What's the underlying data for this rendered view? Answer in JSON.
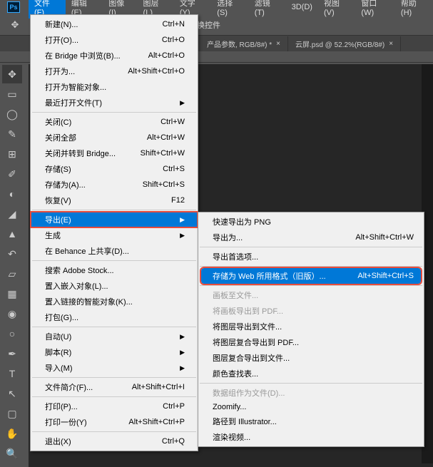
{
  "app": {
    "ps": "Ps"
  },
  "menubar": [
    {
      "label": "文件(F)",
      "active": true
    },
    {
      "label": "编辑(E)"
    },
    {
      "label": "图像(I)"
    },
    {
      "label": "图层(L)"
    },
    {
      "label": "文字(Y)"
    },
    {
      "label": "选择(S)"
    },
    {
      "label": "滤镜(T)"
    },
    {
      "label": "3D(D)"
    },
    {
      "label": "视图(V)"
    },
    {
      "label": "窗口(W)"
    },
    {
      "label": "帮助(H)"
    }
  ],
  "options_bar": {
    "label": "换控件"
  },
  "tabs": [
    {
      "label": "产品参数, RGB/8#) *"
    },
    {
      "label": "云屏.psd @ 52.2%(RGB/8#)"
    }
  ],
  "file_menu": {
    "new": {
      "label": "新建(N)...",
      "kbd": "Ctrl+N"
    },
    "open": {
      "label": "打开(O)...",
      "kbd": "Ctrl+O"
    },
    "browse": {
      "label": "在 Bridge 中浏览(B)...",
      "kbd": "Alt+Ctrl+O"
    },
    "open_as": {
      "label": "打开为...",
      "kbd": "Alt+Shift+Ctrl+O"
    },
    "open_smart": {
      "label": "打开为智能对象..."
    },
    "recent": {
      "label": "最近打开文件(T)"
    },
    "close": {
      "label": "关闭(C)",
      "kbd": "Ctrl+W"
    },
    "close_all": {
      "label": "关闭全部",
      "kbd": "Alt+Ctrl+W"
    },
    "close_bridge": {
      "label": "关闭并转到 Bridge...",
      "kbd": "Shift+Ctrl+W"
    },
    "save": {
      "label": "存储(S)",
      "kbd": "Ctrl+S"
    },
    "save_as": {
      "label": "存储为(A)...",
      "kbd": "Shift+Ctrl+S"
    },
    "revert": {
      "label": "恢复(V)",
      "kbd": "F12"
    },
    "export": {
      "label": "导出(E)"
    },
    "generate": {
      "label": "生成"
    },
    "behance": {
      "label": "在 Behance 上共享(D)..."
    },
    "adobe_stock": {
      "label": "搜索 Adobe Stock..."
    },
    "place_embed": {
      "label": "置入嵌入对象(L)..."
    },
    "place_link": {
      "label": "置入链接的智能对象(K)..."
    },
    "package": {
      "label": "打包(G)..."
    },
    "automate": {
      "label": "自动(U)"
    },
    "scripts": {
      "label": "脚本(R)"
    },
    "import": {
      "label": "导入(M)"
    },
    "file_info": {
      "label": "文件简介(F)...",
      "kbd": "Alt+Shift+Ctrl+I"
    },
    "print": {
      "label": "打印(P)...",
      "kbd": "Ctrl+P"
    },
    "print_one": {
      "label": "打印一份(Y)",
      "kbd": "Alt+Shift+Ctrl+P"
    },
    "exit": {
      "label": "退出(X)",
      "kbd": "Ctrl+Q"
    }
  },
  "export_submenu": {
    "quick_png": {
      "label": "快速导出为 PNG"
    },
    "export_as": {
      "label": "导出为...",
      "kbd": "Alt+Shift+Ctrl+W"
    },
    "prefs": {
      "label": "导出首选项..."
    },
    "save_web": {
      "label": "存储为 Web 所用格式（旧版）...",
      "kbd": "Alt+Shift+Ctrl+S"
    },
    "artboards_files": {
      "label": "画板至文件..."
    },
    "artboards_pdf": {
      "label": "将画板导出到 PDF..."
    },
    "layers_files": {
      "label": "将图层导出到文件..."
    },
    "layer_comps_pdf": {
      "label": "将图层复合导出到 PDF..."
    },
    "layer_comps_files": {
      "label": "图层复合导出到文件..."
    },
    "lut": {
      "label": "颜色查找表..."
    },
    "datasets": {
      "label": "数据组作为文件(D)..."
    },
    "zoomify": {
      "label": "Zoomify..."
    },
    "illustrator": {
      "label": "路径到 Illustrator..."
    },
    "render_video": {
      "label": "渲染视频..."
    }
  }
}
